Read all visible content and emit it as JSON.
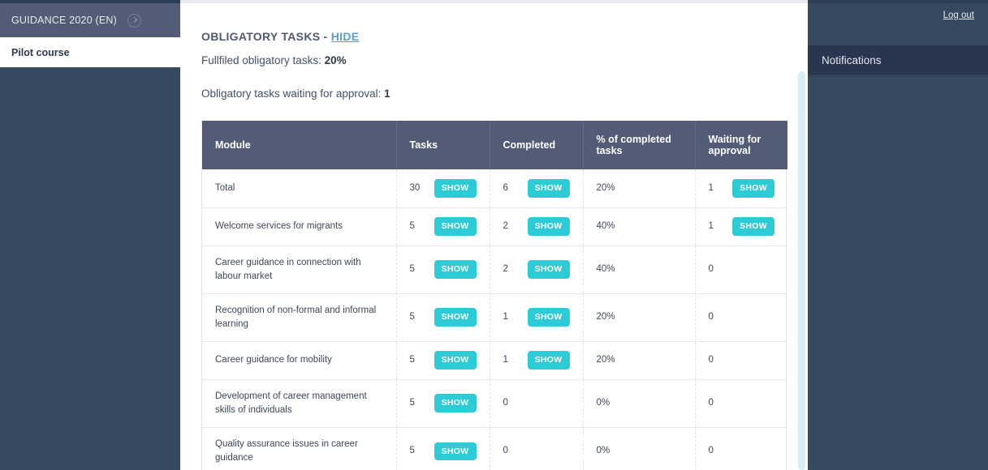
{
  "sidebar": {
    "course_name": "GUIDANCE 2020 (EN)",
    "expand_icon": "circle-chevron-right-icon",
    "sub_item": "Pilot course"
  },
  "right_panel": {
    "logout_label": "Log out",
    "notifications_label": "Notifications"
  },
  "main": {
    "section_title_prefix": "OBLIGATORY TASKS - ",
    "hide_link": "HIDE",
    "fulfilled_label": "Fullfiled obligatory tasks: ",
    "fulfilled_value": "20%",
    "waiting_label": "Obligatory tasks waiting for approval: ",
    "waiting_value": "1",
    "show_button_label": "SHOW"
  },
  "table": {
    "columns": [
      "Module",
      "Tasks",
      "Completed",
      "% of completed tasks",
      "Waiting for approval"
    ],
    "rows": [
      {
        "module": "Total",
        "tasks": "30",
        "tasks_show": true,
        "completed": "6",
        "completed_show": true,
        "pct": "20%",
        "waiting": "1",
        "waiting_show": true,
        "two_line": false
      },
      {
        "module": "Welcome services for migrants",
        "tasks": "5",
        "tasks_show": true,
        "completed": "2",
        "completed_show": true,
        "pct": "40%",
        "waiting": "1",
        "waiting_show": true,
        "two_line": false
      },
      {
        "module": "Career guidance in connection with labour market",
        "tasks": "5",
        "tasks_show": true,
        "completed": "2",
        "completed_show": true,
        "pct": "40%",
        "waiting": "0",
        "waiting_show": false,
        "two_line": true
      },
      {
        "module": "Recognition of non-formal and informal learning",
        "tasks": "5",
        "tasks_show": true,
        "completed": "1",
        "completed_show": true,
        "pct": "20%",
        "waiting": "0",
        "waiting_show": false,
        "two_line": true
      },
      {
        "module": "Career guidance for mobility",
        "tasks": "5",
        "tasks_show": true,
        "completed": "1",
        "completed_show": true,
        "pct": "20%",
        "waiting": "0",
        "waiting_show": false,
        "two_line": false
      },
      {
        "module": "Development of career management skills of individuals",
        "tasks": "5",
        "tasks_show": true,
        "completed": "0",
        "completed_show": false,
        "pct": "0%",
        "waiting": "0",
        "waiting_show": false,
        "two_line": true
      },
      {
        "module": "Quality assurance issues in career guidance",
        "tasks": "5",
        "tasks_show": true,
        "completed": "0",
        "completed_show": false,
        "pct": "0%",
        "waiting": "0",
        "waiting_show": false,
        "two_line": true
      }
    ]
  },
  "colors": {
    "accent_teal": "#2ccbd6",
    "header_slate": "#535c76",
    "panel_navy": "#37495f",
    "notif_navy": "#283650",
    "link_blue": "#5b9bd5",
    "scrollbar_cyan": "#d3eff3"
  }
}
